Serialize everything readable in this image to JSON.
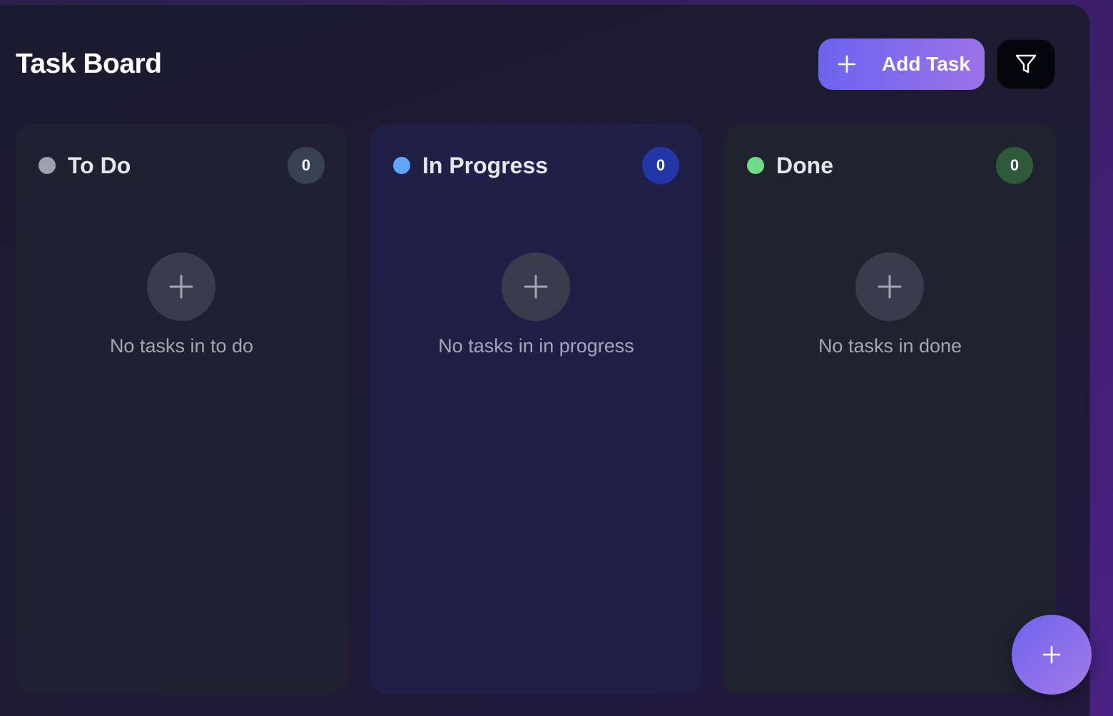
{
  "header": {
    "title": "Task Board",
    "add_task_label": "Add Task"
  },
  "columns": [
    {
      "title": "To Do",
      "count": "0",
      "empty_text": "No tasks in to do",
      "dot_color": "#9ca3af",
      "badge_color": "#394050"
    },
    {
      "title": "In Progress",
      "count": "0",
      "empty_text": "No tasks in in progress",
      "dot_color": "#60a5fa",
      "badge_color": "#2337a8"
    },
    {
      "title": "Done",
      "count": "0",
      "empty_text": "No tasks in done",
      "dot_color": "#6fdc8c",
      "badge_color": "#2e5a39"
    }
  ],
  "icons": {
    "add_task": "plus-icon",
    "filter": "filter-icon",
    "fab": "plus-icon"
  },
  "colors": {
    "accent_start": "#6c63f0",
    "accent_end": "#9b73e8"
  }
}
